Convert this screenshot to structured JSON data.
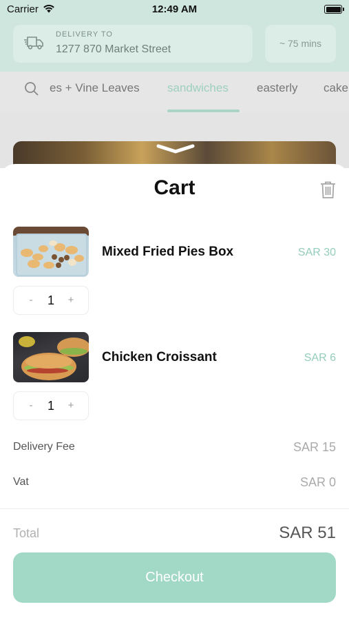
{
  "status_bar": {
    "carrier": "Carrier",
    "time": "12:49 AM"
  },
  "header": {
    "delivery_label": "DELIVERY TO",
    "address": "1277 870 Market Street",
    "eta": "~ 75 mins"
  },
  "categories": {
    "items": [
      {
        "label": "es + Vine Leaves"
      },
      {
        "label": "sandwiches",
        "active": true
      },
      {
        "label": "easterly"
      },
      {
        "label": "cake"
      }
    ]
  },
  "cart": {
    "title": "Cart",
    "items": [
      {
        "name": "Mixed Fried Pies Box",
        "price": "SAR 30",
        "quantity": "1",
        "minus": "-",
        "plus": "+"
      },
      {
        "name": "Chicken Croissant",
        "price": "SAR 6",
        "quantity": "1",
        "minus": "-",
        "plus": "+"
      }
    ],
    "fees": [
      {
        "label": "Delivery Fee",
        "value": "SAR 15"
      },
      {
        "label": "Vat",
        "value": "SAR 0"
      }
    ],
    "total_label": "Total",
    "total_value": "SAR 51",
    "checkout_label": "Checkout"
  },
  "colors": {
    "accent": "#a2d8c6",
    "price": "#94cdbc",
    "header_bg": "#cfe6df"
  }
}
